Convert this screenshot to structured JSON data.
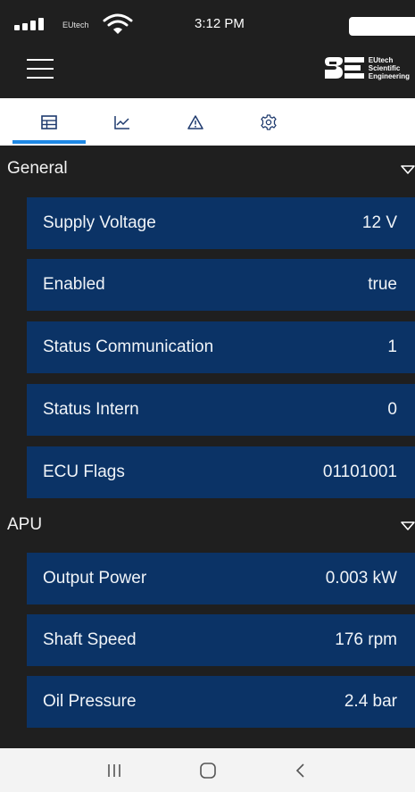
{
  "status_bar": {
    "carrier": "EUtech",
    "time": "3:12 PM"
  },
  "app_bar": {
    "logo_lines": [
      "EUtech",
      "Scientific",
      "Engineering"
    ]
  },
  "tabs": [
    {
      "icon": "table-icon",
      "selected": true
    },
    {
      "icon": "line-chart-icon",
      "selected": false
    },
    {
      "icon": "warning-icon",
      "selected": false
    },
    {
      "icon": "settings-icon",
      "selected": false
    }
  ],
  "colors": {
    "background": "#1f1f1f",
    "row": "#0b3366",
    "accent": "#1e88e5",
    "tab_icon": "#1e3a6e"
  },
  "sections": {
    "general": {
      "title": "General",
      "rows": [
        {
          "label": "Supply Voltage",
          "value": "12 V"
        },
        {
          "label": "Enabled",
          "value": "true"
        },
        {
          "label": "Status Communication",
          "value": "1"
        },
        {
          "label": "Status Intern",
          "value": "0"
        },
        {
          "label": "ECU Flags",
          "value": "01101001"
        }
      ]
    },
    "apu": {
      "title": "APU",
      "rows": [
        {
          "label": "Output Power",
          "value": "0.003 kW"
        },
        {
          "label": "Shaft Speed",
          "value": "176 rpm"
        },
        {
          "label": "Oil Pressure",
          "value": "2.4 bar"
        }
      ]
    }
  },
  "nav_bar": {
    "buttons": [
      "recent-apps-icon",
      "home-icon",
      "back-icon"
    ]
  }
}
